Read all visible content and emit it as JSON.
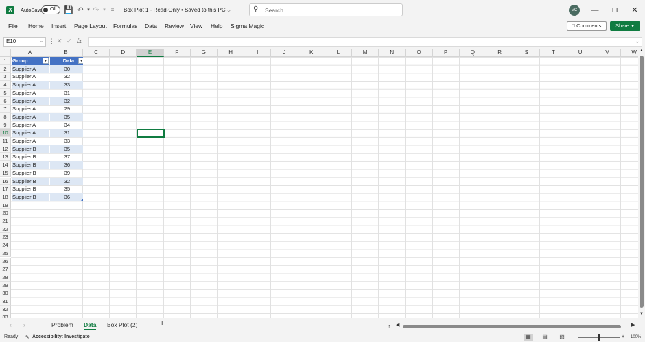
{
  "app": {
    "logo": "X",
    "autosave_label": "AutoSave",
    "autosave_state": "Off",
    "title": "Box Plot 1  -  Read-Only • Saved to this PC",
    "search_placeholder": "Search",
    "avatar_initials": "VC"
  },
  "menu": [
    "File",
    "Home",
    "Insert",
    "Page Layout",
    "Formulas",
    "Data",
    "Review",
    "View",
    "Help",
    "Sigma Magic"
  ],
  "buttons": {
    "comments": "Comments",
    "share": "Share"
  },
  "formula_bar": {
    "name_box": "E10",
    "fx": "fx",
    "formula": ""
  },
  "columns": [
    "A",
    "B",
    "C",
    "D",
    "E",
    "F",
    "G",
    "H",
    "I",
    "J",
    "K",
    "L",
    "M",
    "N",
    "O",
    "P",
    "Q",
    "R",
    "S",
    "T",
    "U",
    "V",
    "W"
  ],
  "selected_column": "E",
  "selected_row": 10,
  "rows": [
    "1",
    "2",
    "3",
    "4",
    "5",
    "6",
    "7",
    "8",
    "9",
    "10",
    "11",
    "12",
    "13",
    "14",
    "15",
    "16",
    "17",
    "18",
    "19",
    "20",
    "21",
    "22",
    "23",
    "24",
    "25",
    "26",
    "27",
    "28",
    "29",
    "30",
    "31",
    "32",
    "33"
  ],
  "table": {
    "headers": [
      "Group",
      "Data"
    ],
    "rows": [
      [
        "Supplier A",
        "30"
      ],
      [
        "Supplier A",
        "32"
      ],
      [
        "Supplier A",
        "33"
      ],
      [
        "Supplier A",
        "31"
      ],
      [
        "Supplier A",
        "32"
      ],
      [
        "Supplier A",
        "29"
      ],
      [
        "Supplier A",
        "35"
      ],
      [
        "Supplier A",
        "34"
      ],
      [
        "Supplier A",
        "31"
      ],
      [
        "Supplier A",
        "33"
      ],
      [
        "Supplier B",
        "35"
      ],
      [
        "Supplier B",
        "37"
      ],
      [
        "Supplier B",
        "36"
      ],
      [
        "Supplier B",
        "39"
      ],
      [
        "Supplier B",
        "32"
      ],
      [
        "Supplier B",
        "35"
      ],
      [
        "Supplier B",
        "36"
      ]
    ]
  },
  "sheet_tabs": [
    "Problem",
    "Data",
    "Box Plot (2)"
  ],
  "active_tab": "Data",
  "status": {
    "ready": "Ready",
    "accessibility": "Accessibility: Investigate",
    "zoom": "100%"
  },
  "colors": {
    "accent": "#107c41",
    "table_header": "#4472c4",
    "table_band": "#dde7f4"
  }
}
